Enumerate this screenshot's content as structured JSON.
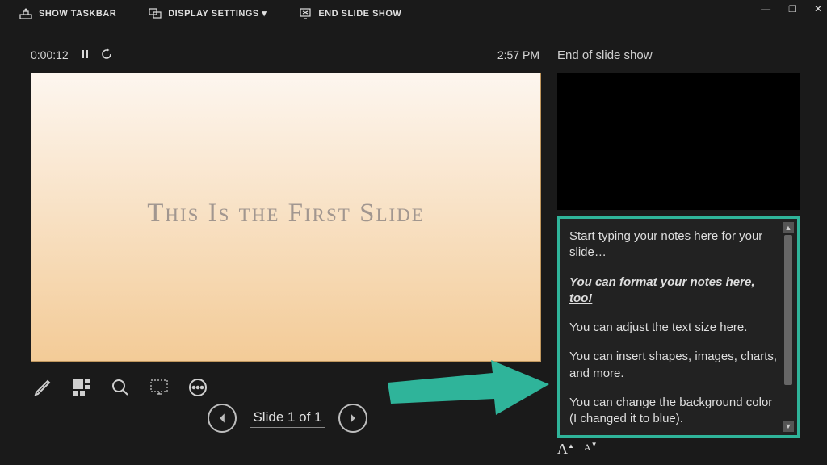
{
  "toolbar": {
    "show_taskbar": "SHOW TASKBAR",
    "display_settings": "DISPLAY SETTINGS ▾",
    "end_slide_show": "END SLIDE SHOW"
  },
  "presenter": {
    "timer": "0:00:12",
    "clock": "2:57 PM"
  },
  "slide": {
    "title": "This Is the First Slide"
  },
  "nav": {
    "indicator": "Slide 1 of 1"
  },
  "next": {
    "label": "End of slide show"
  },
  "notes": {
    "p1": "Start typing your notes here for your slide…",
    "p2": "You can format your notes here, too!",
    "p3": "You can adjust the text size here.",
    "p4": "You can insert shapes, images, charts, and more.",
    "p5": "You can change the background color (I changed it to blue)."
  },
  "icons": {
    "show_taskbar": "show-taskbar-icon",
    "display_settings": "display-settings-icon",
    "end_slide_show": "end-slide-show-icon",
    "pause": "pause-icon",
    "restart": "restart-icon",
    "pen": "pen-icon",
    "see_all": "see-all-slides-icon",
    "zoom": "zoom-icon",
    "black_screen": "black-screen-icon",
    "more": "more-options-icon",
    "prev": "prev-slide-icon",
    "next": "next-slide-icon",
    "font_increase": "font-increase-icon",
    "font_decrease": "font-decrease-icon",
    "minimize": "minimize-icon",
    "restore": "restore-icon",
    "close": "close-icon"
  }
}
